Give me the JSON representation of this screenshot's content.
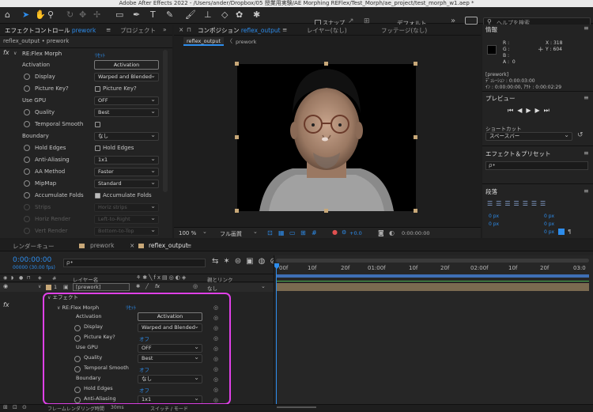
{
  "titlebar": {
    "text": "Adobe After Effects 2022 - /Users/ander/Dropbox/05 授業用実験/AE Morphing REFlex/Test_Morph/ae_project/test_morph_w1.aep *"
  },
  "toolbar": {
    "snap_label": "スナップ",
    "workspace_label": "デフォルト",
    "help_placeholder": "ヘルプを検索"
  },
  "effect_controls": {
    "tab_label": "エフェクトコントロール",
    "tab_target": "prework",
    "tab_project": "プロジェクト",
    "breadcrumb": "reflex_output • prework",
    "effect_name": "RE:Flex Morph",
    "reset_label": "ﾘｾｯﾄ",
    "rows": [
      {
        "label": "Activation",
        "button": "Activation"
      },
      {
        "label": "Display",
        "select": "Warped and Blended"
      },
      {
        "label": "Picture Key?",
        "checkbox": "Picture Key?"
      },
      {
        "label": "Use GPU",
        "select": "OFF"
      },
      {
        "label": "Quality",
        "select": "Best"
      },
      {
        "label": "Temporal Smooth"
      },
      {
        "label": "Boundary",
        "select": "なし"
      },
      {
        "label": "Hold Edges",
        "checkbox": "Hold Edges"
      },
      {
        "label": "Anti-Aliasing",
        "select": "1x1"
      },
      {
        "label": "AA Method",
        "select": "Faster"
      },
      {
        "label": "MipMap",
        "select": "Standard"
      },
      {
        "label": "Accumulate Folds",
        "checkbox": "Accumulate Folds"
      },
      {
        "label": "Strips",
        "select": "Horiz strips"
      },
      {
        "label": "Horiz Render",
        "select": "Left-to-Right"
      },
      {
        "label": "Vert Render",
        "select": "Bottom-to-Top"
      }
    ]
  },
  "composition": {
    "tab_label": "コンポジション",
    "tab_target": "reflex_output",
    "tab_layer": "レイヤー(なし)",
    "tab_footage": "フッテージ(なし)",
    "crumb_current": "reflex_output",
    "crumb_sub": "prework",
    "zoom": "100 %",
    "resolution": "フル画質",
    "exposure": "+0.0",
    "timecode": "0:00:00:00"
  },
  "info": {
    "title": "情報",
    "r": "R :",
    "g": "G :",
    "b": "B :",
    "a": "A :  0",
    "x": "X : 318",
    "y": "Y : 604",
    "item": "[prework]",
    "duration": "ﾃﾞｭﾚｰｼｮﾝ : 0:00:03:00",
    "in_out": "ｲﾝ : 0:00:00:00, ｱｳﾄ : 0:00:02:29"
  },
  "preview": {
    "title": "プレビュー",
    "shortcut_label": "ショートカット",
    "shortcut_value": "スペースバー"
  },
  "effects_presets": {
    "title": "エフェクト＆プリセット",
    "search_placeholder": "ρ•"
  },
  "paragraph": {
    "title": "段落",
    "v1": "0 px",
    "v2": "0 px",
    "v3": "0 px",
    "v4": "0 px",
    "v5": "0 px"
  },
  "timeline": {
    "tab_render": "レンダーキュー",
    "tab_prework": "prework",
    "tab_reflex": "reflex_output",
    "timecode": "0:00:00:00",
    "fps": "00000 (30.00 fps)",
    "search_placeholder": "ρ•",
    "col_hash": "#",
    "col_layer": "レイヤー名",
    "col_parent": "親とリンク",
    "layer_num": "1",
    "layer_name": "[prework]",
    "layer_parent": "なし",
    "ruler": [
      "00f",
      "10f",
      "20f",
      "01:00f",
      "10f",
      "20f",
      "02:00f",
      "10f",
      "20f",
      "03:0"
    ],
    "bottom_left": "フレームレンダリング時間",
    "bottom_time": "30ms",
    "bottom_right": "スイッチ / モード",
    "rows": [
      {
        "label": "エフェクト",
        "indent": 0
      },
      {
        "label": "RE:Flex Morph",
        "indent": 1,
        "reset": "ﾘｾｯﾄ"
      },
      {
        "label": "Activation",
        "indent": 2,
        "button": "Activation"
      },
      {
        "label": "Display",
        "indent": 2,
        "select": "Warped and Blended"
      },
      {
        "label": "Picture Key?",
        "indent": 2,
        "value": "オフ"
      },
      {
        "label": "Use GPU",
        "indent": 2,
        "select": "OFF"
      },
      {
        "label": "Quality",
        "indent": 2,
        "select": "Best"
      },
      {
        "label": "Temporal Smooth",
        "indent": 2,
        "value": "オフ"
      },
      {
        "label": "Boundary",
        "indent": 2,
        "select": "なし"
      },
      {
        "label": "Hold Edges",
        "indent": 2,
        "value": "オフ"
      },
      {
        "label": "Anti-Aliasing",
        "indent": 2,
        "select": "1x1"
      }
    ]
  },
  "colors": {
    "accent": "#2d8ceb",
    "highlight": "#e040e8",
    "label_tan": "#c8a878",
    "work_area": "#3f6fb5"
  }
}
